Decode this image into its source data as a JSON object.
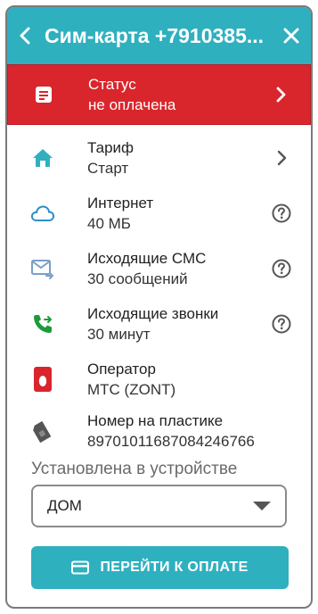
{
  "header": {
    "title": "Сим-карта +7910385...",
    "back_icon": "chevron-left-icon",
    "close_icon": "close-icon"
  },
  "colors": {
    "accent": "#2fb0bf",
    "status_red": "#d9262c",
    "operator_red": "#d9262c"
  },
  "rows": {
    "status": {
      "title": "Статус",
      "value": "не оплачена",
      "icon": "document-icon"
    },
    "tariff": {
      "title": "Тариф",
      "value": "Старт",
      "icon": "home-icon"
    },
    "internet": {
      "title": "Интернет",
      "value": "40 МБ",
      "icon": "cloud-icon"
    },
    "sms": {
      "title": "Исходящие СМС",
      "value": "30 сообщений",
      "icon": "mail-outgoing-icon"
    },
    "calls": {
      "title": "Исходящие звонки",
      "value": "30 минут",
      "icon": "phone-outgoing-icon"
    },
    "operator": {
      "title": "Оператор",
      "value": "МТС (ZONT)",
      "icon": "mts-logo-icon"
    },
    "plastic": {
      "title": "Номер на пластике",
      "value": "89701011687084246766",
      "icon": "sim-card-icon"
    }
  },
  "device": {
    "label": "Установлена в устройстве",
    "selected": "ДОМ"
  },
  "pay_button": {
    "label": "ПЕРЕЙТИ К ОПЛАТЕ",
    "icon": "credit-card-icon"
  }
}
